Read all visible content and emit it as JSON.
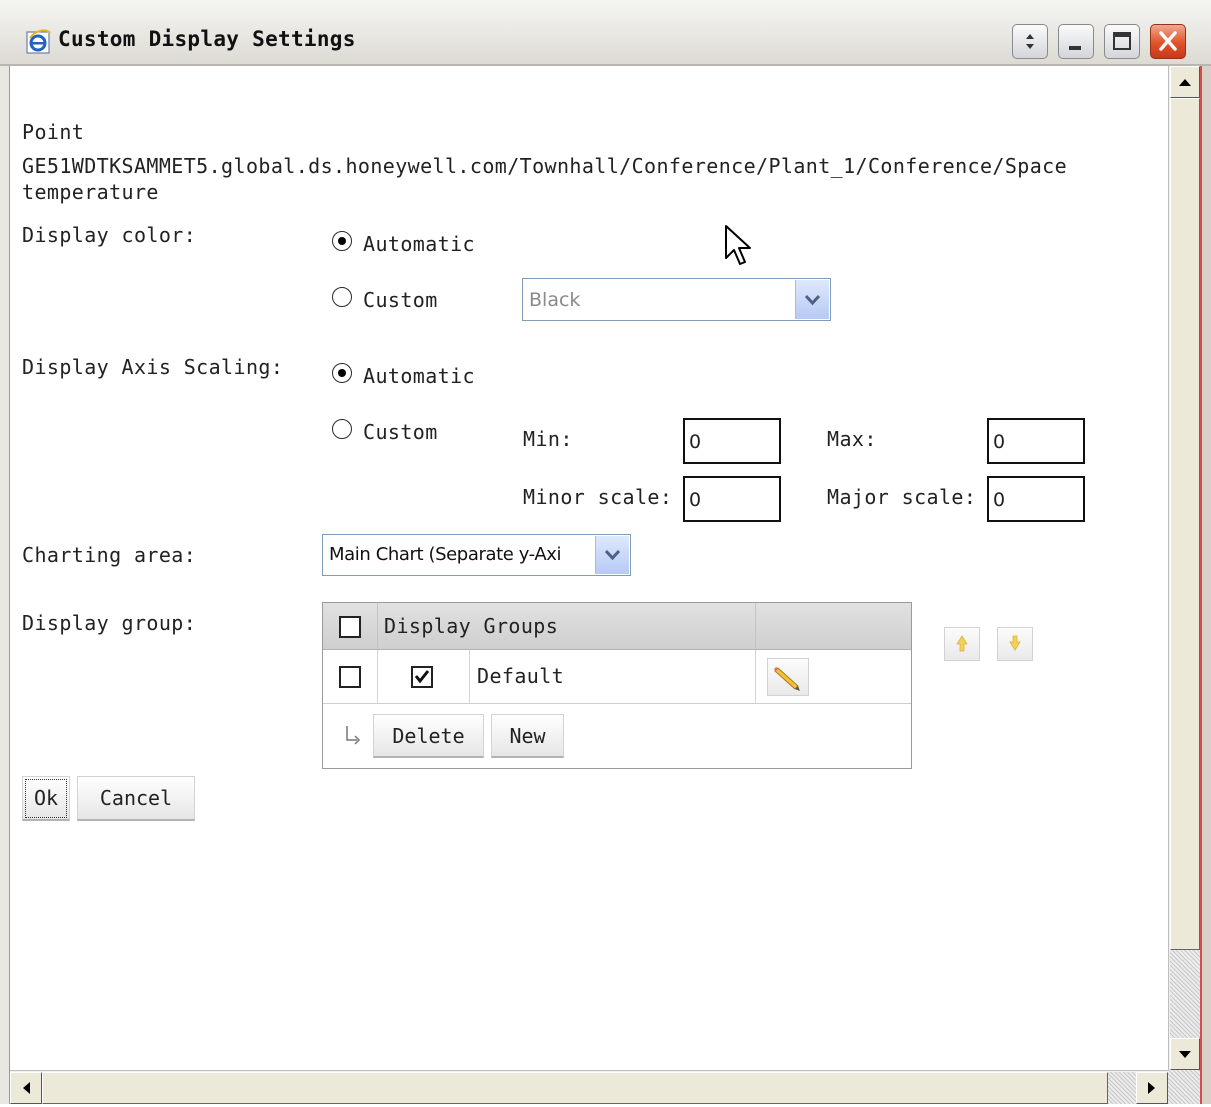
{
  "window": {
    "title": "Custom Display Settings"
  },
  "point": {
    "label": "Point",
    "path_line1": "GE51WDTKSAMMET5.global.ds.honeywell.com/Townhall/Conference/Plant_1/Conference/Space",
    "path_line2": "temperature"
  },
  "display_color": {
    "label": "Display color:",
    "automatic_label": "Automatic",
    "custom_label": "Custom",
    "selected": "Automatic",
    "color_select_value": "Black"
  },
  "axis_scaling": {
    "label": "Display Axis Scaling:",
    "automatic_label": "Automatic",
    "custom_label": "Custom",
    "selected": "Automatic",
    "min_label": "Min:",
    "min_value": "0",
    "max_label": "Max:",
    "max_value": "0",
    "minor_label": "Minor scale:",
    "minor_value": "0",
    "major_label": "Major scale:",
    "major_value": "0"
  },
  "charting_area": {
    "label": "Charting area:",
    "value": "Main Chart (Separate y-Axi"
  },
  "display_group": {
    "label": "Display group:",
    "header": "Display Groups",
    "rows": [
      {
        "name": "Default",
        "selected": false,
        "checked": true
      }
    ],
    "delete_label": "Delete",
    "new_label": "New"
  },
  "buttons": {
    "ok": "Ok",
    "cancel": "Cancel"
  },
  "icons": {
    "title": "ie-icon",
    "title_buttons": [
      "restore-arrows-icon",
      "minimize-icon",
      "maximize-icon",
      "close-icon"
    ],
    "edit": "pencil-icon",
    "move_up": "move-up-icon",
    "move_down": "move-down-icon",
    "indent": "return-arrow-icon"
  },
  "colors": {
    "close_button": "#d9472b",
    "select_border": "#7f9db9",
    "grid_header": "#d6d6d6"
  }
}
